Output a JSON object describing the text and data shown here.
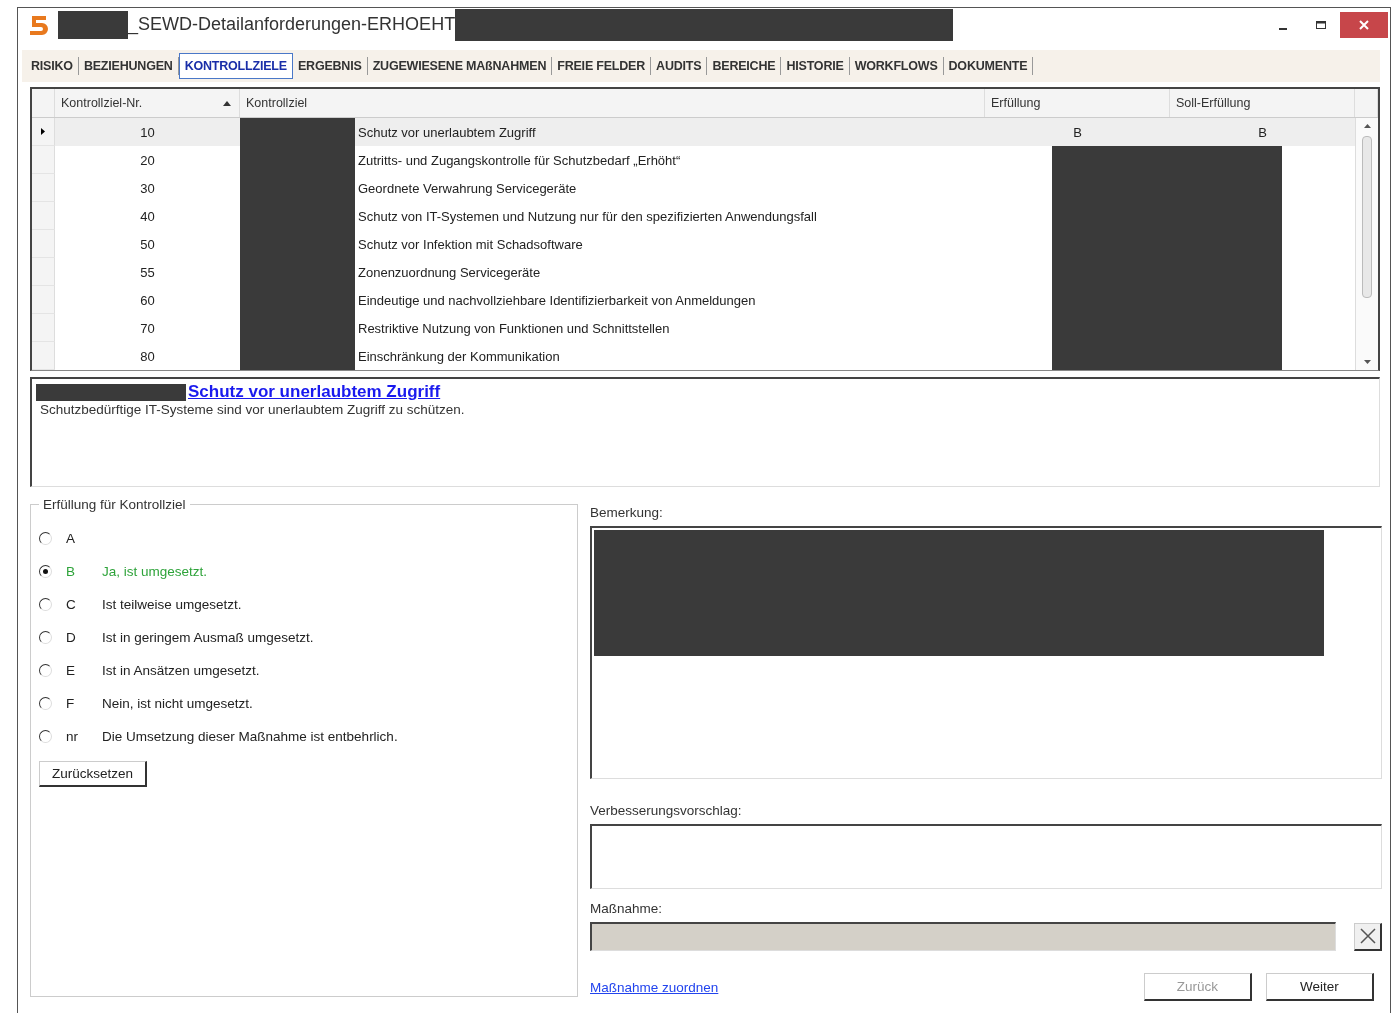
{
  "window": {
    "title": "_SEWD-Detailanforderungen-ERHOEHT"
  },
  "tabs": [
    {
      "label": "RISIKO",
      "selected": false
    },
    {
      "label": "BEZIEHUNGEN",
      "selected": false
    },
    {
      "label": "KONTROLLZIELE",
      "selected": true
    },
    {
      "label": "ERGEBNIS",
      "selected": false
    },
    {
      "label": "ZUGEWIESENE MAßNAHMEN",
      "selected": false
    },
    {
      "label": "FREIE FELDER",
      "selected": false
    },
    {
      "label": "AUDITS",
      "selected": false
    },
    {
      "label": "BEREICHE",
      "selected": false
    },
    {
      "label": "HISTORIE",
      "selected": false
    },
    {
      "label": "WORKFLOWS",
      "selected": false
    },
    {
      "label": "DOKUMENTE",
      "selected": false
    }
  ],
  "table": {
    "columns": [
      "Kontrollziel-Nr.",
      "Kontrollziel",
      "Erfüllung",
      "Soll-Erfüllung"
    ],
    "rows": [
      {
        "nr": "10",
        "title": "Schutz vor unerlaubtem Zugriff",
        "erfuellung": "B",
        "soll": "B",
        "selected": true
      },
      {
        "nr": "20",
        "title": "Zutritts- und Zugangskontrolle für Schutzbedarf „Erhöht“",
        "selected": false
      },
      {
        "nr": "30",
        "title": "Geordnete Verwahrung Servicegeräte",
        "selected": false
      },
      {
        "nr": "40",
        "title": "Schutz von IT-Systemen und Nutzung nur für den spezifizierten Anwendungsfall",
        "selected": false
      },
      {
        "nr": "50",
        "title": "Schutz vor Infektion mit Schadsoftware",
        "selected": false
      },
      {
        "nr": "55",
        "title": "Zonenzuordnung Servicegeräte",
        "selected": false
      },
      {
        "nr": "60",
        "title": "Eindeutige und nachvollziehbare Identifizierbarkeit von Anmeldungen",
        "selected": false
      },
      {
        "nr": "70",
        "title": "Restriktive Nutzung von Funktionen und Schnittstellen",
        "selected": false
      },
      {
        "nr": "80",
        "title": "Einschränkung der Kommunikation",
        "selected": false
      }
    ]
  },
  "description": {
    "heading": "Schutz vor unerlaubtem Zugriff",
    "text": "Schutzbedürftige IT-Systeme sind vor unerlaubtem Zugriff zu schützen."
  },
  "fulfillment": {
    "legend": "Erfüllung für Kontrollziel",
    "options": [
      {
        "code": "A",
        "selected": false
      },
      {
        "code": "B",
        "text": "Ja, ist umgesetzt.",
        "selected": true
      },
      {
        "code": "C",
        "text": "Ist teilweise umgesetzt.",
        "selected": false
      },
      {
        "code": "D",
        "text": "Ist in geringem Ausmaß umgesetzt.",
        "selected": false
      },
      {
        "code": "E",
        "text": "Ist in Ansätzen umgesetzt.",
        "selected": false
      },
      {
        "code": "F",
        "text": "Nein, ist nicht umgesetzt.",
        "selected": false
      },
      {
        "code": "nr",
        "text": "Die Umsetzung dieser Maßnahme ist entbehrlich.",
        "selected": false
      }
    ],
    "reset_button": "Zurücksetzen"
  },
  "remark": {
    "label": "Bemerkung:"
  },
  "improvement": {
    "label": "Verbesserungsvorschlag:"
  },
  "measure": {
    "label": "Maßnahme:",
    "disabled": true
  },
  "assign_link": "Maßnahme zuordnen",
  "buttons": [
    {
      "label": "Zurück",
      "disabled": true
    },
    {
      "label": "Weiter",
      "disabled": false
    }
  ]
}
